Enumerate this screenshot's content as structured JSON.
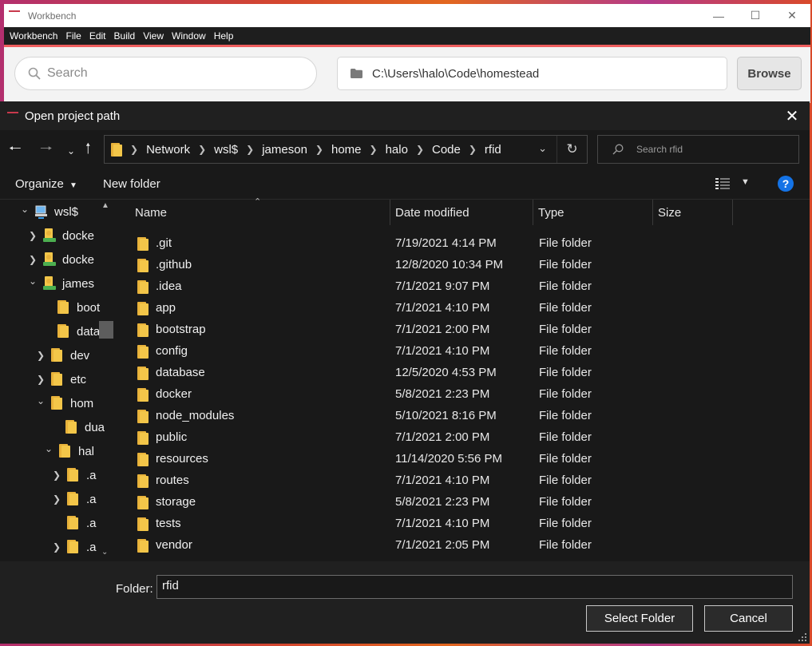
{
  "workbench": {
    "title": "Workbench",
    "menu": [
      "Workbench",
      "File",
      "Edit",
      "Build",
      "View",
      "Window",
      "Help"
    ],
    "search_placeholder": "Search",
    "path": "C:\\Users\\halo\\Code\\homestead",
    "browse_label": "Browse",
    "accent_color": "#ef5e5e"
  },
  "dialog": {
    "title": "Open project path",
    "breadcrumb": [
      "Network",
      "wsl$",
      "jameson",
      "home",
      "halo",
      "Code",
      "rfid"
    ],
    "search_placeholder": "Search rfid",
    "organize_label": "Organize",
    "new_folder_label": "New folder",
    "help_label": "?",
    "tree": [
      {
        "label": "wsl$",
        "expand": "expanded",
        "icon": "network-computer-icon"
      },
      {
        "label": "docke",
        "expand": "collapsed",
        "icon": "linux-drive-icon"
      },
      {
        "label": "docke",
        "expand": "collapsed",
        "icon": "linux-drive-icon"
      },
      {
        "label": "james",
        "expand": "expanded",
        "icon": "linux-drive-icon"
      },
      {
        "label": "boot",
        "expand": "none",
        "icon": "folder-icon"
      },
      {
        "label": "data",
        "expand": "none",
        "icon": "folder-icon"
      },
      {
        "label": "dev",
        "expand": "collapsed",
        "icon": "folder-icon"
      },
      {
        "label": "etc",
        "expand": "collapsed",
        "icon": "folder-icon"
      },
      {
        "label": "hom",
        "expand": "expanded",
        "icon": "folder-icon"
      },
      {
        "label": "dua",
        "expand": "none",
        "icon": "folder-icon"
      },
      {
        "label": "hal",
        "expand": "expanded",
        "icon": "folder-icon"
      },
      {
        "label": ".a",
        "expand": "collapsed",
        "icon": "folder-icon"
      },
      {
        "label": ".a",
        "expand": "collapsed",
        "icon": "folder-icon"
      },
      {
        "label": ".a",
        "expand": "none",
        "icon": "folder-icon"
      },
      {
        "label": ".a",
        "expand": "collapsed",
        "icon": "folder-icon"
      }
    ],
    "columns": {
      "name": "Name",
      "date": "Date modified",
      "type": "Type",
      "size": "Size"
    },
    "files": [
      {
        "name": ".git",
        "date": "7/19/2021 4:14 PM",
        "type": "File folder"
      },
      {
        "name": ".github",
        "date": "12/8/2020 10:34 PM",
        "type": "File folder"
      },
      {
        "name": ".idea",
        "date": "7/1/2021 9:07 PM",
        "type": "File folder"
      },
      {
        "name": "app",
        "date": "7/1/2021 4:10 PM",
        "type": "File folder"
      },
      {
        "name": "bootstrap",
        "date": "7/1/2021 2:00 PM",
        "type": "File folder"
      },
      {
        "name": "config",
        "date": "7/1/2021 4:10 PM",
        "type": "File folder"
      },
      {
        "name": "database",
        "date": "12/5/2020 4:53 PM",
        "type": "File folder"
      },
      {
        "name": "docker",
        "date": "5/8/2021 2:23 PM",
        "type": "File folder"
      },
      {
        "name": "node_modules",
        "date": "5/10/2021 8:16 PM",
        "type": "File folder"
      },
      {
        "name": "public",
        "date": "7/1/2021 2:00 PM",
        "type": "File folder"
      },
      {
        "name": "resources",
        "date": "11/14/2020 5:56 PM",
        "type": "File folder"
      },
      {
        "name": "routes",
        "date": "7/1/2021 4:10 PM",
        "type": "File folder"
      },
      {
        "name": "storage",
        "date": "5/8/2021 2:23 PM",
        "type": "File folder"
      },
      {
        "name": "tests",
        "date": "7/1/2021 4:10 PM",
        "type": "File folder"
      },
      {
        "name": "vendor",
        "date": "7/1/2021 2:05 PM",
        "type": "File folder"
      }
    ],
    "folder_label": "Folder:",
    "folder_value": "rfid",
    "select_label": "Select Folder",
    "cancel_label": "Cancel",
    "folder_color": "#f3c649",
    "help_color": "#1473e6"
  }
}
